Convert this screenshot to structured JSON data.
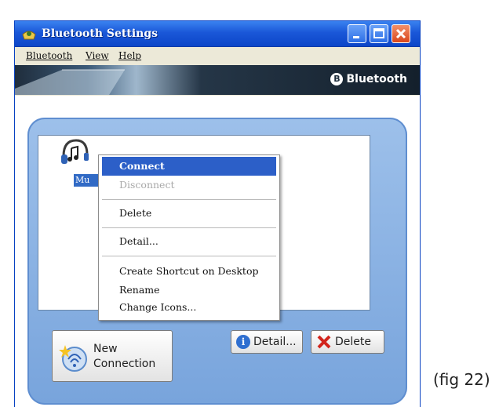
{
  "window": {
    "title": "Bluetooth Settings",
    "icon": "bluetooth-devices-icon",
    "controls": [
      "minimize-icon",
      "maximize-icon",
      "close-icon"
    ]
  },
  "menubar": {
    "items": [
      "Bluetooth",
      "View",
      "Help"
    ]
  },
  "banner": {
    "logo_text": "Bluetooth",
    "logo_symbol": "B"
  },
  "device": {
    "label": "Mu",
    "icon": "headset-icon"
  },
  "context_menu": {
    "items": [
      {
        "label": "Connect",
        "state": "selected"
      },
      {
        "label": "Disconnect",
        "state": "disabled"
      },
      {
        "label": "Delete",
        "state": "normal"
      },
      {
        "label": "Detail...",
        "state": "normal"
      },
      {
        "label": "Create Shortcut on Desktop",
        "state": "normal"
      },
      {
        "label": "Rename",
        "state": "normal"
      },
      {
        "label": "Change Icons...",
        "state": "normal"
      }
    ]
  },
  "buttons": {
    "new_connection_line1": "New",
    "new_connection_line2": "Connection",
    "detail": "Detail...",
    "delete": "Delete"
  },
  "caption": "(fig 22)",
  "colors": {
    "titlebar": "#1a57d8",
    "selection": "#2c5fc8",
    "panel": "#8ab2e3"
  }
}
